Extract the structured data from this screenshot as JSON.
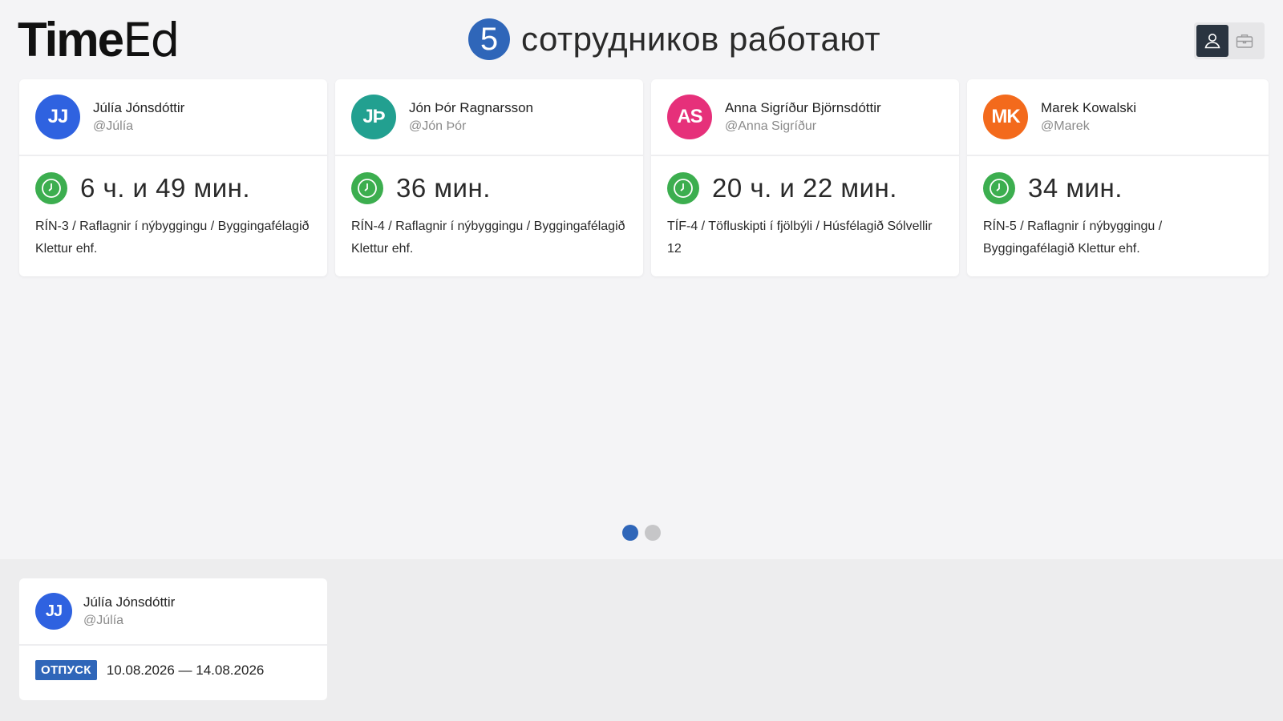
{
  "app": {
    "logo_bold": "Time",
    "logo_light": "Ed"
  },
  "header": {
    "count": "5",
    "headline": "сотрудников работают"
  },
  "colors": {
    "accent": "#2f66b9",
    "clock_green": "#3cae4f"
  },
  "employees": [
    {
      "initials": "JJ",
      "avatar_color": "#2f62e0",
      "name": "Júlía Jónsdóttir",
      "handle": "@Júlía",
      "duration": "6 ч. и 49 мин.",
      "task": "RÍN-3 / Raflagnir í nýbyggingu / Byggingafélagið Klettur ehf."
    },
    {
      "initials": "JÞ",
      "avatar_color": "#22a090",
      "name": "Jón Þór Ragnarsson",
      "handle": "@Jón Þór",
      "duration": "36 мин.",
      "task": "RÍN-4 / Raflagnir í nýbyggingu / Byggingafélagið Klettur ehf."
    },
    {
      "initials": "AS",
      "avatar_color": "#e6307a",
      "name": "Anna Sigríður Björnsdóttir",
      "handle": "@Anna Sigríður",
      "duration": "20 ч. и 22 мин.",
      "task": "TÍF-4 / Töfluskipti í fjölbýli / Húsfélagið Sólvellir 12"
    },
    {
      "initials": "MK",
      "avatar_color": "#f36a1c",
      "name": "Marek Kowalski",
      "handle": "@Marek",
      "duration": "34 мин.",
      "task": "RÍN-5 / Raflagnir í nýbyggingu / Byggingafélagið Klettur ehf."
    }
  ],
  "pagination": {
    "pages": 2,
    "current": 1
  },
  "leave": {
    "initials": "JJ",
    "avatar_color": "#2f62e0",
    "name": "Júlía Jónsdóttir",
    "handle": "@Júlía",
    "badge": "ОТПУСК",
    "dates": "10.08.2026 — 14.08.2026"
  }
}
